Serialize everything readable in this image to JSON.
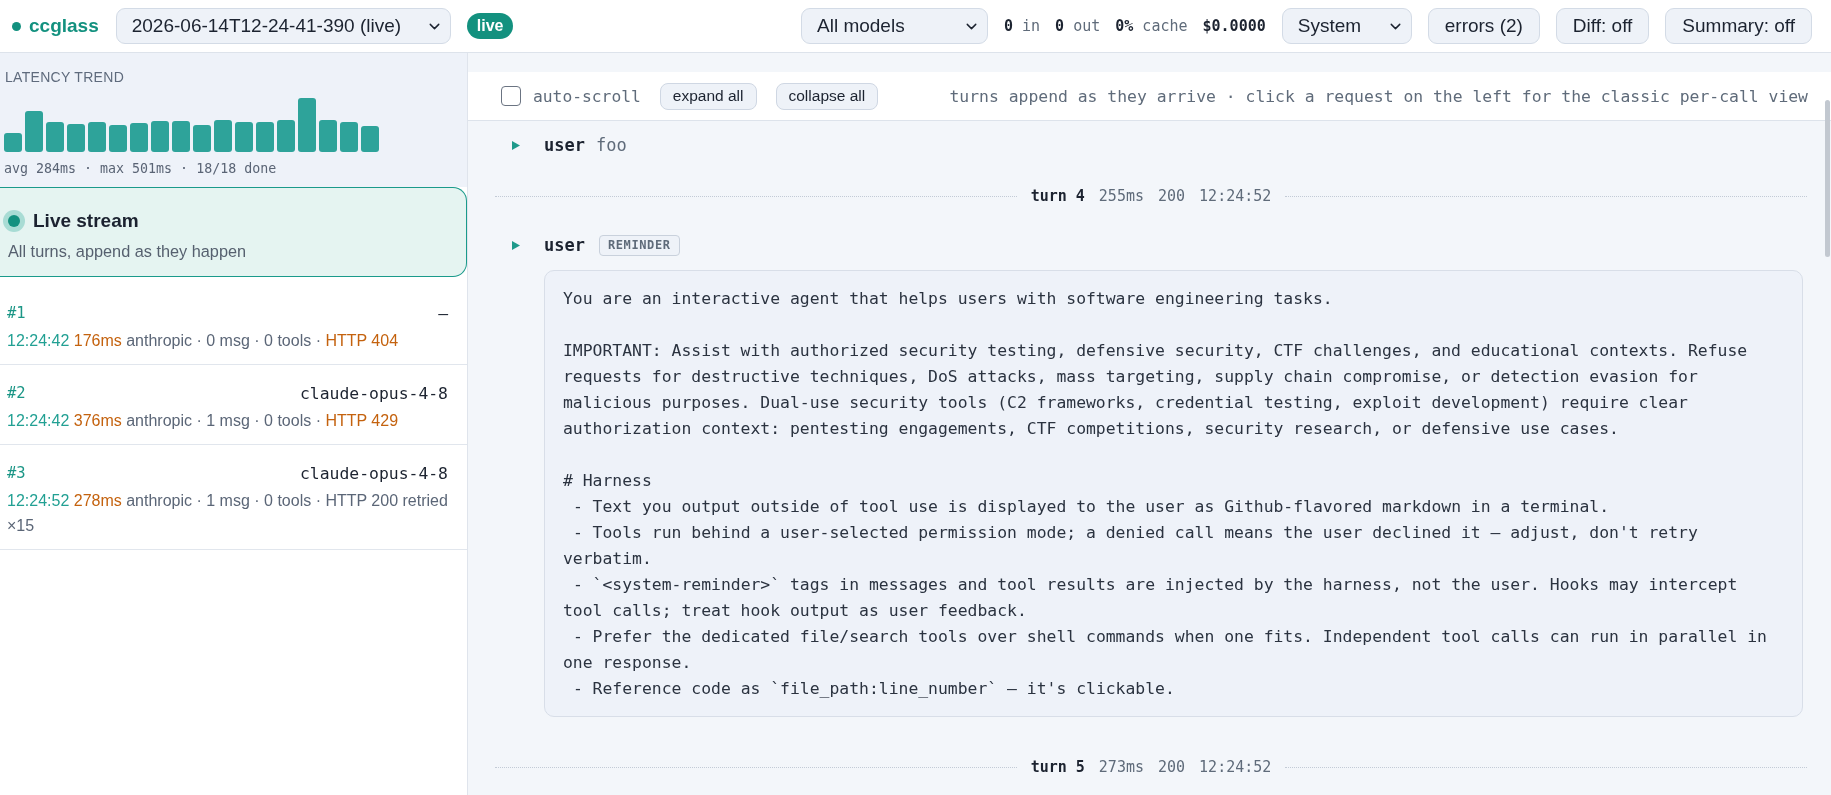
{
  "header": {
    "app_name": "ccglass",
    "session": "2026-06-14T12-24-41-390 (live)",
    "live_badge": "live",
    "model_filter": "All models",
    "token_stats": [
      "**0** in",
      "**0** out",
      "**0%** cache"
    ],
    "cost": "$0.0000",
    "view_select": "System",
    "buttons": [
      "errors (2)",
      "Diff: off",
      "Summary: off"
    ]
  },
  "sidebar": {
    "latency": {
      "title": "LATENCY TREND",
      "summary": "avg 284ms · max 501ms · 18/18 done"
    },
    "live_stream": {
      "title": "Live stream",
      "subtitle": "All turns, append as they happen",
      "selected": true
    },
    "requests": [
      {
        "number": "#1",
        "model": "—",
        "time": "12:24:42",
        "duration": "176ms",
        "details": "anthropic · 0 msg · 0 tools ·",
        "status": "HTTP 404",
        "error": true,
        "selected": false
      },
      {
        "number": "#2",
        "model": "claude-opus-4-8",
        "time": "12:24:42",
        "duration": "376ms",
        "details": "anthropic · 1 msg · 0 tools ·",
        "status": "HTTP 429",
        "error": true,
        "selected": false
      },
      {
        "number": "#3",
        "model": "claude-opus-4-8",
        "time": "12:24:52",
        "duration": "278ms",
        "details": "anthropic · 1 msg · 0 tools ·",
        "status": "HTTP 200 retried ×15",
        "error": false,
        "selected": false
      }
    ]
  },
  "toolbar": {
    "auto_scroll": {
      "label": "auto-scroll",
      "checked": false
    },
    "buttons": [
      "expand all",
      "collapse all"
    ],
    "hint": "turns append as they arrive · click a request on the left for the classic per-call view"
  },
  "timeline": [
    {
      "kind": "message",
      "role": "user",
      "preview": "foo"
    },
    {
      "kind": "turn",
      "label": "turn 4",
      "duration": "255ms",
      "status": "200",
      "time": "12:24:52"
    },
    {
      "kind": "message",
      "role": "user",
      "tag": "REMINDER",
      "content": "You are an interactive agent that helps users with software engineering tasks.\n\nIMPORTANT: Assist with authorized security testing, defensive security, CTF challenges, and educational contexts. Refuse requests for destructive techniques, DoS attacks, mass targeting, supply chain compromise, or detection evasion for malicious purposes. Dual-use security tools (C2 frameworks, credential testing, exploit development) require clear authorization context: pentesting engagements, CTF competitions, security research, or defensive use cases.\n\n# Harness\n - Text you output outside of tool use is displayed to the user as Github-flavored markdown in a terminal.\n - Tools run behind a user-selected permission mode; a denied call means the user declined it — adjust, don't retry verbatim.\n - `<system-reminder>` tags in messages and tool results are injected by the harness, not the user. Hooks may intercept tool calls; treat hook output as user feedback.\n - Prefer the dedicated file/search tools over shell commands when one fits. Independent tool calls can run in parallel in one response.\n - Reference code as `file_path:line_number` — it's clickable."
    },
    {
      "kind": "turn",
      "label": "turn 5",
      "duration": "273ms",
      "status": "200",
      "time": "12:24:52"
    }
  ]
}
